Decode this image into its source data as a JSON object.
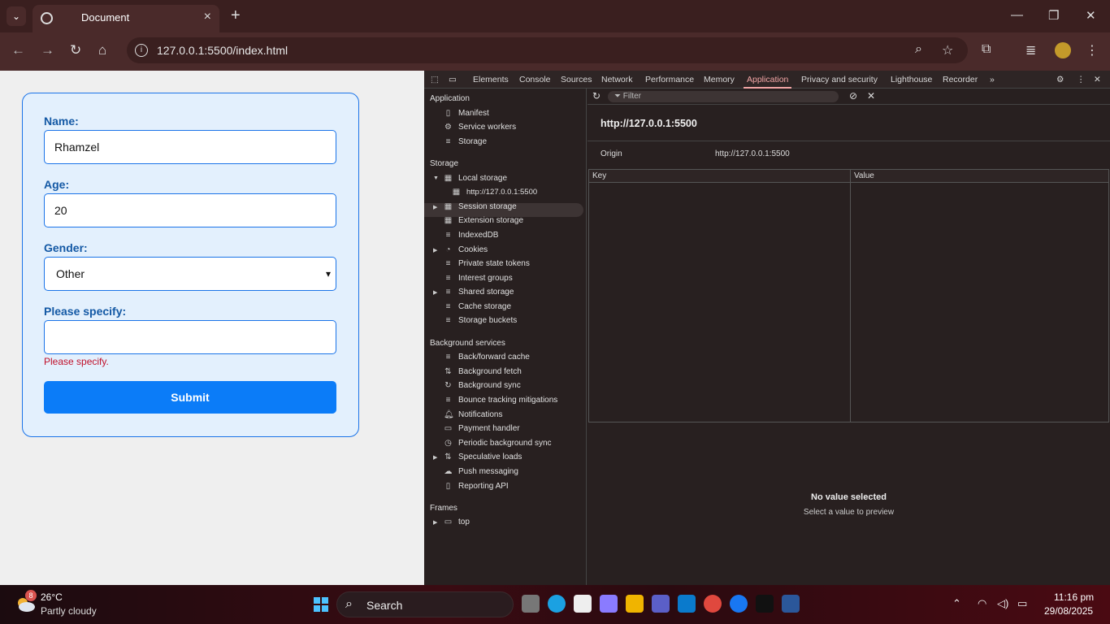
{
  "browser": {
    "tab_title": "Document",
    "new_tab": "+",
    "url": "127.0.0.1:5500/index.html"
  },
  "form": {
    "name_label": "Name:",
    "name_value": "Rhamzel",
    "age_label": "Age:",
    "age_value": "20",
    "gender_label": "Gender:",
    "gender_value": "Other",
    "specify_label": "Please specify:",
    "specify_value": "",
    "error_text": "Please specify.",
    "submit_label": "Submit"
  },
  "devtools": {
    "tabs": [
      "Elements",
      "Console",
      "Sources",
      "Network",
      "Performance",
      "Memory",
      "Application",
      "Privacy and security",
      "Lighthouse",
      "Recorder"
    ],
    "active_tab": "Application",
    "sections": {
      "application": "Application",
      "storage": "Storage",
      "background": "Background services",
      "frames": "Frames"
    },
    "application_items": [
      "Manifest",
      "Service workers",
      "Storage"
    ],
    "storage_items": [
      "Local storage",
      "http://127.0.0.1:5500",
      "Session storage",
      "Extension storage",
      "IndexedDB",
      "Cookies",
      "Private state tokens",
      "Interest groups",
      "Shared storage",
      "Cache storage",
      "Storage buckets"
    ],
    "background_items": [
      "Back/forward cache",
      "Background fetch",
      "Background sync",
      "Bounce tracking mitigations",
      "Notifications",
      "Payment handler",
      "Periodic background sync",
      "Speculative loads",
      "Push messaging",
      "Reporting API"
    ],
    "frames_items": [
      "top"
    ],
    "filter_placeholder": "Filter",
    "origin_title": "http://127.0.0.1:5500",
    "origin_label": "Origin",
    "origin_value": "http://127.0.0.1:5500",
    "key_header": "Key",
    "value_header": "Value",
    "no_value": "No value selected",
    "no_value_hint": "Select a value to preview"
  },
  "taskbar": {
    "temperature": "26°C",
    "weather": "Partly cloudy",
    "weather_badge": "8",
    "search": "Search",
    "time": "11:16 pm",
    "date": "29/08/2025"
  }
}
